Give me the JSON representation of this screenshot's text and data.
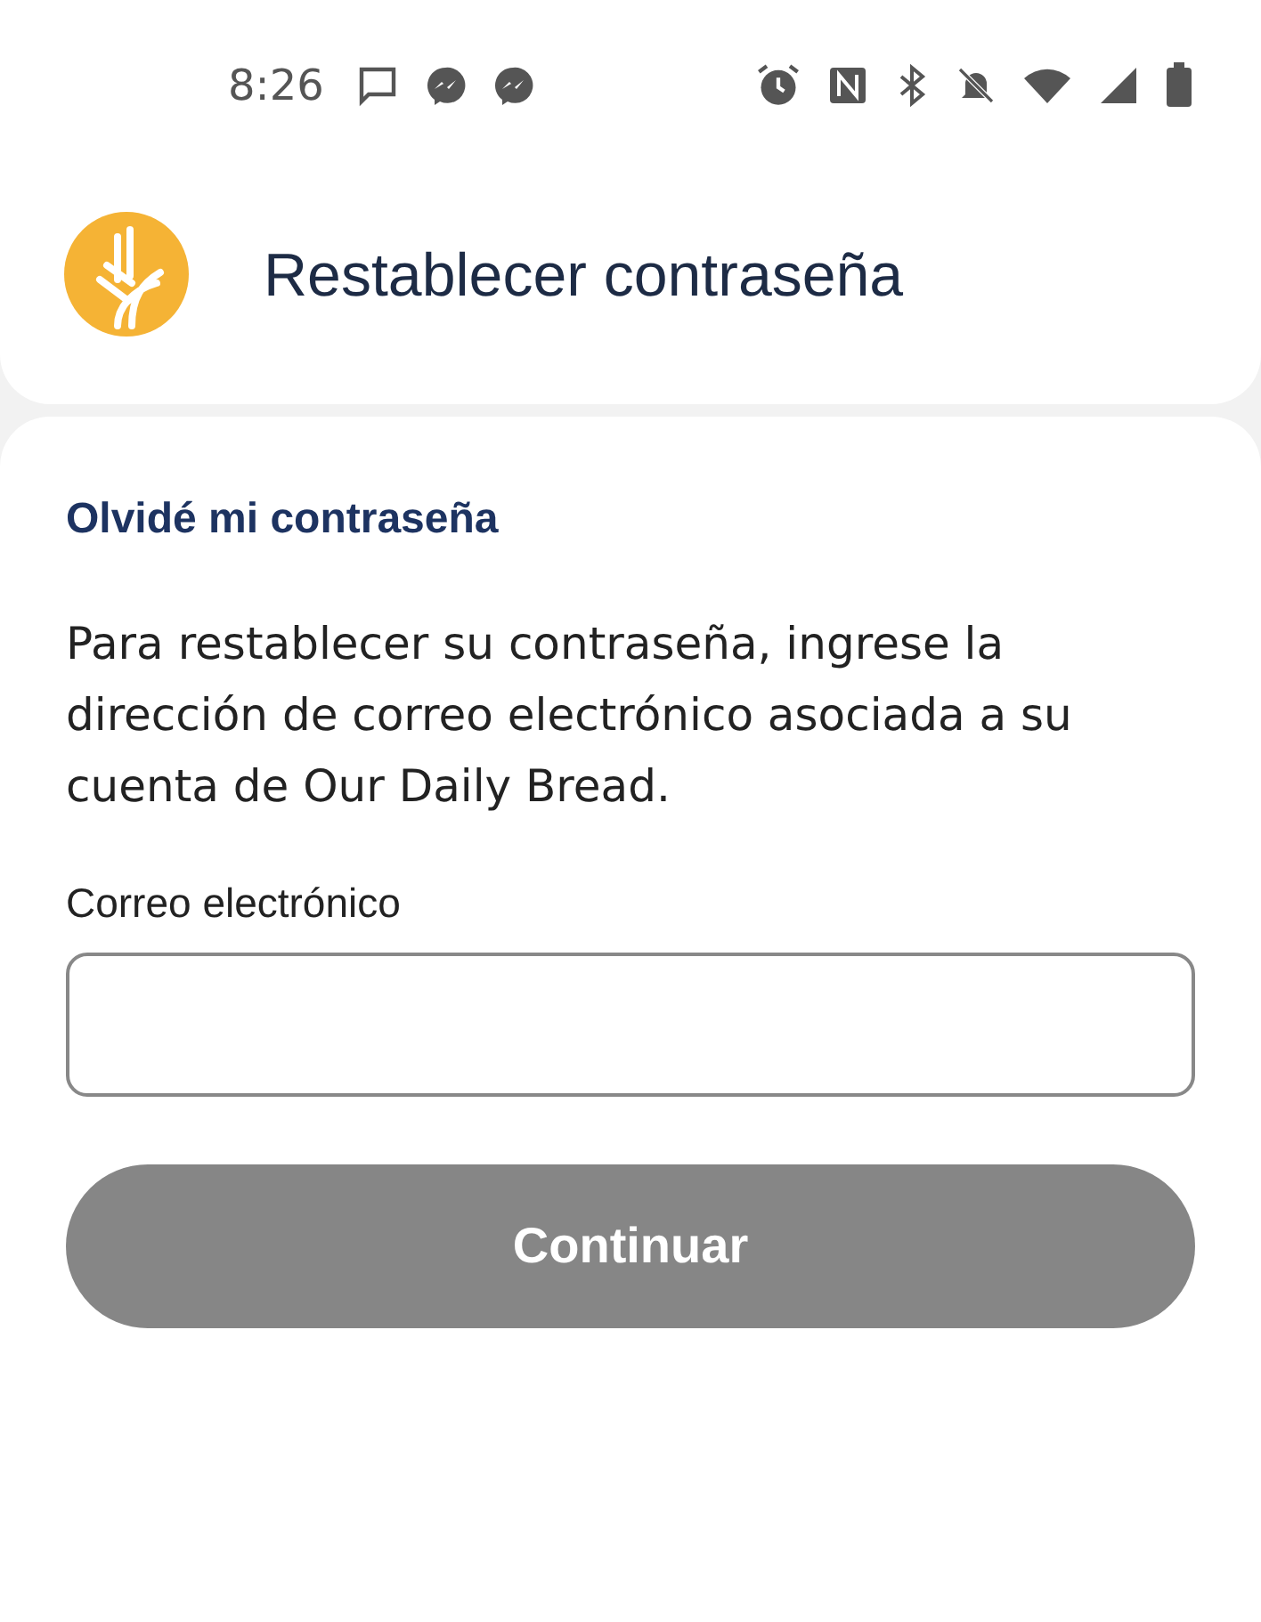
{
  "status_bar": {
    "time": "8:26"
  },
  "header": {
    "title": "Restablecer contraseña"
  },
  "form": {
    "heading": "Olvidé mi contraseña",
    "description": "Para restablecer su contraseña, ingrese la dirección de correo electrónico asociada a su cuenta de Our Daily Bread.",
    "email_label": "Correo electrónico",
    "button": {
      "label": "Continuar",
      "disabled": true
    }
  }
}
